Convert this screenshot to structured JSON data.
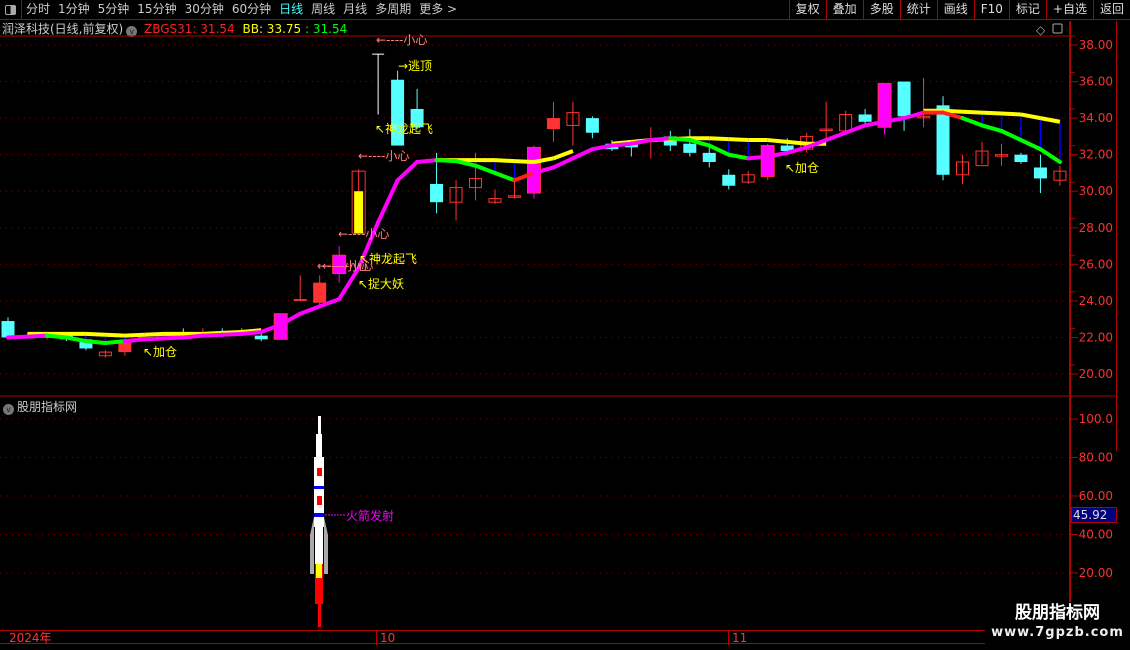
{
  "toolbar": {
    "periods": [
      "分时",
      "1分钟",
      "5分钟",
      "15分钟",
      "30分钟",
      "60分钟",
      "日线",
      "周线",
      "月线",
      "多周期",
      "更多 >"
    ],
    "active_period": "日线",
    "right_buttons": [
      "复权",
      "叠加",
      "多股",
      "统计",
      "画线",
      "F10",
      "标记",
      "+自选",
      "返回"
    ]
  },
  "info": {
    "stock": "润泽科技(日线,前复权)",
    "ind1_label": "ZBGS31: 31.54",
    "ind2_label": "BB: 33.75",
    "ind3_label": ": 31.54"
  },
  "colors": {
    "up": "#ff3333",
    "down": "#55ffff",
    "signal": "#ff00ff",
    "bb": "#ffff00",
    "fall": "#00ff00",
    "axis": "#b00000"
  },
  "chart_data": [
    {
      "type": "candlestick",
      "ylim": [
        19,
        39
      ],
      "yticks": [
        "20.00",
        "22.00",
        "24.00",
        "26.00",
        "28.00",
        "30.00",
        "32.00",
        "34.00",
        "36.00",
        "38.00"
      ],
      "candles": [
        {
          "o": 22.9,
          "h": 23.1,
          "l": 21.9,
          "c": 22.0,
          "t": "d"
        },
        {
          "o": 22.1,
          "h": 22.2,
          "l": 22.0,
          "c": 22.1,
          "t": "d"
        },
        {
          "o": 22.0,
          "h": 22.2,
          "l": 21.9,
          "c": 22.1,
          "t": "u"
        },
        {
          "o": 22.1,
          "h": 22.2,
          "l": 21.8,
          "c": 21.9,
          "t": "d"
        },
        {
          "o": 21.9,
          "h": 22.1,
          "l": 21.3,
          "c": 21.4,
          "t": "d"
        },
        {
          "o": 21.0,
          "h": 21.3,
          "l": 20.9,
          "c": 21.2,
          "t": "u"
        },
        {
          "o": 21.2,
          "h": 22.0,
          "l": 21.0,
          "c": 21.8,
          "t": "uf"
        },
        {
          "o": 21.9,
          "h": 22.2,
          "l": 21.8,
          "c": 22.0,
          "t": "u"
        },
        {
          "o": 22.1,
          "h": 22.3,
          "l": 21.9,
          "c": 22.1,
          "t": "u"
        },
        {
          "o": 22.3,
          "h": 22.5,
          "l": 22.0,
          "c": 22.3,
          "t": "d"
        },
        {
          "o": 22.2,
          "h": 22.5,
          "l": 22.0,
          "c": 22.2,
          "t": "u"
        },
        {
          "o": 22.3,
          "h": 22.5,
          "l": 22.1,
          "c": 22.3,
          "t": "d"
        },
        {
          "o": 22.3,
          "h": 22.5,
          "l": 22.2,
          "c": 22.3,
          "t": "d"
        },
        {
          "o": 22.1,
          "h": 22.3,
          "l": 21.8,
          "c": 21.9,
          "t": "d"
        },
        {
          "o": 21.9,
          "h": 23.3,
          "l": 21.9,
          "c": 23.3,
          "t": "s"
        },
        {
          "o": 24.0,
          "h": 25.4,
          "l": 24.0,
          "c": 24.1,
          "t": "uf"
        },
        {
          "o": 23.9,
          "h": 25.4,
          "l": 23.8,
          "c": 25.0,
          "t": "uf"
        },
        {
          "o": 25.5,
          "h": 27.0,
          "l": 25.0,
          "c": 26.5,
          "t": "s"
        },
        {
          "o": 27.7,
          "h": 31.2,
          "l": 27.7,
          "c": 31.1,
          "t": "y"
        },
        {
          "o": 35.7,
          "h": 37.5,
          "l": 34.2,
          "c": 35.7,
          "t": "w"
        },
        {
          "o": 36.1,
          "h": 36.6,
          "l": 32.5,
          "c": 32.5,
          "t": "d"
        },
        {
          "o": 34.5,
          "h": 35.6,
          "l": 33.4,
          "c": 33.5,
          "t": "d"
        },
        {
          "o": 30.4,
          "h": 32.1,
          "l": 28.8,
          "c": 29.4,
          "t": "d"
        },
        {
          "o": 29.4,
          "h": 30.6,
          "l": 28.4,
          "c": 30.2,
          "t": "u"
        },
        {
          "o": 30.2,
          "h": 32.1,
          "l": 29.5,
          "c": 30.7,
          "t": "u"
        },
        {
          "o": 29.4,
          "h": 30.1,
          "l": 29.3,
          "c": 29.6,
          "t": "u"
        },
        {
          "o": 29.7,
          "h": 31.0,
          "l": 29.6,
          "c": 29.75,
          "t": "u"
        },
        {
          "o": 29.9,
          "h": 32.5,
          "l": 29.6,
          "c": 32.4,
          "t": "s"
        },
        {
          "o": 33.4,
          "h": 34.9,
          "l": 32.7,
          "c": 34.0,
          "t": "uf"
        },
        {
          "o": 33.6,
          "h": 34.9,
          "l": 32.5,
          "c": 34.3,
          "t": "u"
        },
        {
          "o": 34.0,
          "h": 34.1,
          "l": 32.9,
          "c": 33.2,
          "t": "d"
        },
        {
          "o": 32.6,
          "h": 32.8,
          "l": 32.2,
          "c": 32.3,
          "t": "d"
        },
        {
          "o": 32.6,
          "h": 32.7,
          "l": 31.9,
          "c": 32.4,
          "t": "d"
        },
        {
          "o": 32.8,
          "h": 33.5,
          "l": 31.8,
          "c": 32.8,
          "t": "u"
        },
        {
          "o": 33.0,
          "h": 33.3,
          "l": 32.2,
          "c": 32.5,
          "t": "d"
        },
        {
          "o": 32.6,
          "h": 33.4,
          "l": 31.9,
          "c": 32.1,
          "t": "d"
        },
        {
          "o": 32.1,
          "h": 32.4,
          "l": 31.3,
          "c": 31.6,
          "t": "d"
        },
        {
          "o": 30.9,
          "h": 31.2,
          "l": 30.1,
          "c": 30.3,
          "t": "d"
        },
        {
          "o": 30.5,
          "h": 31.1,
          "l": 30.4,
          "c": 30.9,
          "t": "u"
        },
        {
          "o": 30.8,
          "h": 32.6,
          "l": 30.6,
          "c": 32.5,
          "t": "s"
        },
        {
          "o": 32.5,
          "h": 32.9,
          "l": 32.1,
          "c": 32.2,
          "t": "d"
        },
        {
          "o": 32.3,
          "h": 33.2,
          "l": 32.1,
          "c": 33.0,
          "t": "u"
        },
        {
          "o": 33.4,
          "h": 34.9,
          "l": 32.9,
          "c": 33.4,
          "t": "u"
        },
        {
          "o": 33.3,
          "h": 34.4,
          "l": 33.2,
          "c": 34.2,
          "t": "u"
        },
        {
          "o": 34.2,
          "h": 34.5,
          "l": 33.7,
          "c": 33.8,
          "t": "d"
        },
        {
          "o": 33.5,
          "h": 35.9,
          "l": 33.1,
          "c": 35.9,
          "t": "s"
        },
        {
          "o": 36.0,
          "h": 36.0,
          "l": 33.3,
          "c": 34.1,
          "t": "d"
        },
        {
          "o": 34.1,
          "h": 36.2,
          "l": 33.5,
          "c": 34.1,
          "t": "u"
        },
        {
          "o": 34.7,
          "h": 35.2,
          "l": 30.6,
          "c": 30.9,
          "t": "d"
        },
        {
          "o": 30.9,
          "h": 32.0,
          "l": 30.4,
          "c": 31.6,
          "t": "u"
        },
        {
          "o": 31.4,
          "h": 32.7,
          "l": 31.5,
          "c": 32.2,
          "t": "u"
        },
        {
          "o": 32.0,
          "h": 32.6,
          "l": 31.4,
          "c": 32.0,
          "t": "u"
        },
        {
          "o": 32.0,
          "h": 32.1,
          "l": 31.5,
          "c": 31.6,
          "t": "d"
        },
        {
          "o": 31.3,
          "h": 32.0,
          "l": 29.9,
          "c": 30.7,
          "t": "d"
        },
        {
          "o": 30.6,
          "h": 31.4,
          "l": 30.3,
          "c": 31.1,
          "t": "u"
        }
      ],
      "zbgs_line": [
        22.0,
        22.05,
        22.1,
        22.0,
        21.8,
        21.7,
        21.8,
        21.9,
        21.95,
        22.0,
        22.1,
        22.15,
        22.2,
        22.3,
        22.7,
        23.3,
        23.7,
        24.1,
        25.8,
        28.3,
        30.6,
        31.6,
        31.7,
        31.65,
        31.4,
        31.0,
        30.6,
        31.0,
        31.3,
        31.8,
        32.3,
        32.5,
        32.6,
        32.8,
        32.9,
        32.8,
        32.5,
        32.0,
        31.8,
        31.9,
        32.1,
        32.4,
        32.8,
        33.2,
        33.6,
        33.8,
        34.0,
        34.3,
        34.3,
        34.0,
        33.6,
        33.3,
        32.8,
        32.3,
        31.6
      ],
      "zbgs_segment_colors": [
        "m",
        "m",
        "m",
        "g",
        "g",
        "g",
        "g",
        "m",
        "m",
        "m",
        "m",
        "m",
        "m",
        "m",
        "m",
        "m",
        "m",
        "m",
        "m",
        "m",
        "m",
        "m",
        "m",
        "g",
        "g",
        "g",
        "g",
        "r",
        "m",
        "m",
        "m",
        "m",
        "m",
        "m",
        "m",
        "g",
        "g",
        "g",
        "g",
        "m",
        "m",
        "m",
        "m",
        "m",
        "m",
        "m",
        "m",
        "m",
        "r",
        "r",
        "g",
        "g",
        "g",
        "g",
        "g"
      ],
      "bb_line": [
        null,
        22.2,
        22.2,
        22.2,
        22.2,
        22.15,
        22.1,
        22.15,
        22.2,
        22.2,
        22.2,
        22.25,
        22.3,
        22.4,
        null,
        null,
        null,
        null,
        null,
        null,
        null,
        null,
        31.7,
        31.7,
        31.7,
        31.7,
        31.65,
        31.6,
        31.8,
        32.2,
        null,
        32.6,
        32.7,
        32.8,
        32.85,
        32.9,
        32.9,
        32.85,
        32.8,
        32.8,
        32.7,
        32.6,
        32.6,
        null,
        null,
        null,
        null,
        34.4,
        34.4,
        34.35,
        34.3,
        34.25,
        34.2,
        34.0,
        33.8
      ],
      "annotations": [
        {
          "text": "↖加仓",
          "color": "#ffff00"
        },
        {
          "text": "↖捉大妖",
          "color": "#ffff00"
        },
        {
          "text": "↖神龙起飞",
          "color": "#ffff00"
        },
        {
          "text": "←----小心",
          "color": "#ff8080"
        },
        {
          "text": "←----小心",
          "color": "#ff8080"
        },
        {
          "text": "←----小心",
          "color": "#ff8080"
        },
        {
          "text": "←----小心",
          "color": "#ff8080"
        },
        {
          "text": "↖神龙起飞",
          "color": "#ffff00"
        },
        {
          "text": "→逃顶",
          "color": "#ffff00"
        },
        {
          "text": "←----小心",
          "color": "#ff8080"
        },
        {
          "text": "↖加仓",
          "color": "#ffff00"
        },
        {
          "text": "↖加仓",
          "color": "#ffff00"
        }
      ]
    },
    {
      "type": "indicator",
      "title": "股朋指标网",
      "ylim": [
        0,
        110
      ],
      "yticks": [
        "20.00",
        "40.00",
        "60.00",
        "80.00",
        "100.0"
      ],
      "current_value": "45.92",
      "signal_label": "火箭发射"
    }
  ],
  "date_axis": [
    "2024年",
    "10",
    "11"
  ],
  "watermark": {
    "line1": "股朋指标网",
    "line2": "www.7gpzb.com"
  }
}
